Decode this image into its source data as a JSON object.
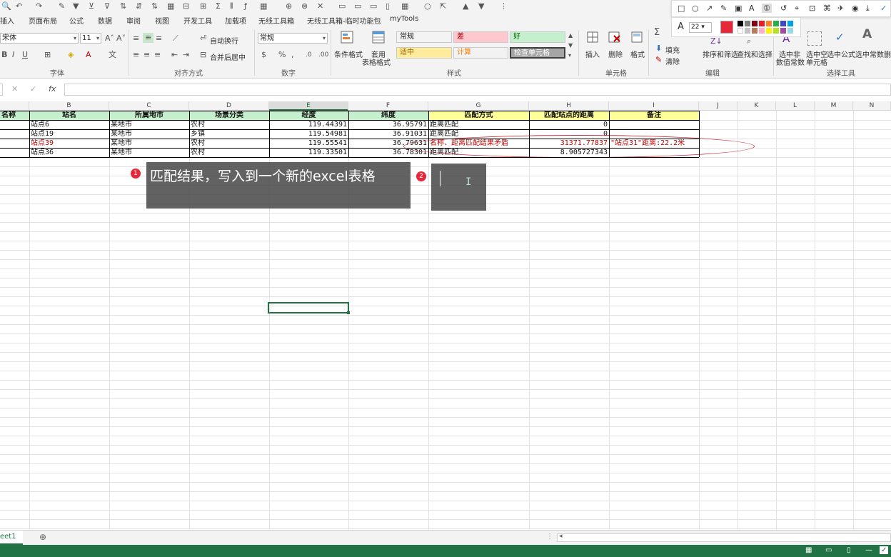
{
  "ribbon": {
    "tabs": [
      "插入",
      "页面布局",
      "公式",
      "数据",
      "审阅",
      "视图",
      "开发工具",
      "加载项",
      "无线工具箱",
      "无线工具箱-临时功能包",
      "myTools"
    ],
    "font": {
      "name": "宋体",
      "size": "11",
      "group_label": "字体"
    },
    "alignment": {
      "wrap": "自动换行",
      "merge": "合并后居中",
      "group_label": "对齐方式"
    },
    "number": {
      "format": "常规",
      "group_label": "数字"
    },
    "styles": {
      "conditional": "条件格式",
      "table_format": "套用",
      "table_format2": "表格格式",
      "cells": [
        {
          "label": "常规",
          "bg": "#ffffff",
          "color": "#000000"
        },
        {
          "label": "差",
          "bg": "#ffc7ce",
          "color": "#9c0006"
        },
        {
          "label": "好",
          "bg": "#c6efce",
          "color": "#006100"
        },
        {
          "label": "适中",
          "bg": "#ffeb9c",
          "color": "#9c6500"
        },
        {
          "label": "计算",
          "bg": "#f2f2f2",
          "color": "#fa7d00"
        },
        {
          "label": "检查单元格",
          "bg": "#a5a5a5",
          "color": "#ffffff"
        }
      ],
      "group_label": "样式"
    },
    "cells_group": {
      "insert": "插入",
      "delete": "删除",
      "format": "格式",
      "group_label": "单元格"
    },
    "editing": {
      "fill": "填充",
      "clear": "清除",
      "sort": "排序和筛选",
      "find": "查找和选择",
      "group_label": "编辑"
    },
    "select_tools": {
      "nonnum": "选中非",
      "nonnum2": "数值常数",
      "empty": "选中空",
      "empty2": "单元格",
      "formula": "选中公式",
      "const": "选中常数",
      "del": "删",
      "group_label": "选择工具"
    }
  },
  "annotation_toolbar": {
    "size": "22"
  },
  "formula_bar": {
    "fx": "fx"
  },
  "columns": [
    "",
    "B",
    "C",
    "D",
    "E",
    "F",
    "G",
    "H",
    "I",
    "J",
    "K",
    "L",
    "M",
    "N"
  ],
  "table": {
    "headers": [
      "名称",
      "站名",
      "所属地市",
      "场景分类",
      "经度",
      "纬度",
      "匹配方式",
      "匹配站点的距离",
      "备注"
    ],
    "rows": [
      [
        "",
        "站点6",
        "某地市",
        "农村",
        "119.44391",
        "36.95791",
        "距离匹配",
        "0",
        ""
      ],
      [
        "",
        "站点19",
        "某地市",
        "乡镇",
        "119.54981",
        "36.91031",
        "距离匹配",
        "0",
        ""
      ],
      [
        "",
        "站点39",
        "某地市",
        "农村",
        "119.55541",
        "36.79631",
        "名称、距离匹配结果矛盾",
        "31371.77837",
        "\"站点31\"距离:22.2米"
      ],
      [
        "",
        "站点36",
        "某地市",
        "农村",
        "119.33501",
        "36.78301",
        "距离匹配",
        "8.905727343",
        ""
      ]
    ]
  },
  "callouts": [
    {
      "num": "1",
      "text": "匹配结果，写入到一个新的excel表格"
    },
    {
      "num": "2",
      "text": ""
    }
  ],
  "sheet_tab": "eet1",
  "colors": {
    "accent": "#217346",
    "annotation_red": "#d0303b"
  }
}
